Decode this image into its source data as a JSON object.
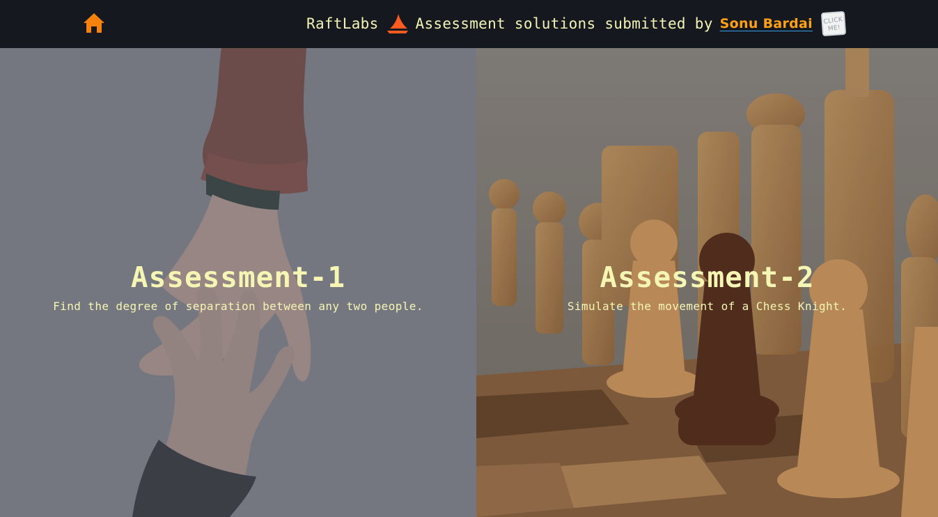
{
  "header": {
    "brand": "RaftLabs",
    "tagline": "Assessment solutions submitted by",
    "author": "Sonu Bardai",
    "click_me_text": "CLICK ME!"
  },
  "cards": [
    {
      "title": "Assessment-1",
      "description": "Find the degree of separation between any two people."
    },
    {
      "title": "Assessment-2",
      "description": "Simulate the movement of a Chess Knight."
    }
  ],
  "colors": {
    "header_bg": "#15191f",
    "header_text": "#f3f3b4",
    "accent_orange": "#f7810d",
    "card_text": "#f6f6b4"
  },
  "icons": {
    "home": "home-icon",
    "brand": "raftlabs-logo",
    "click_me": "click-me-sticker"
  }
}
